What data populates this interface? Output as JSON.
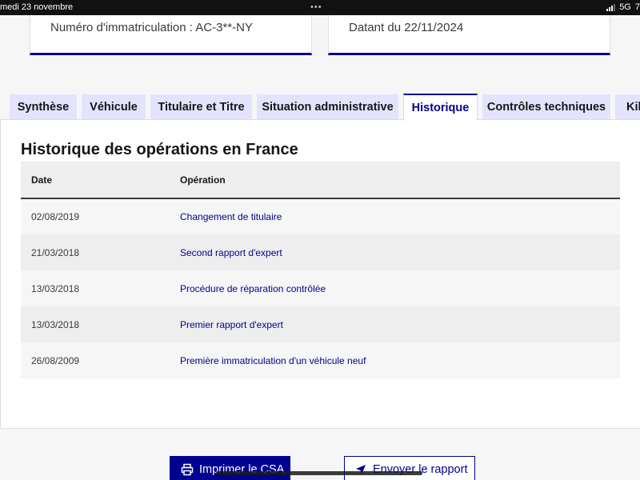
{
  "status_bar": {
    "date": "medi 23 novembre",
    "dots": "•••",
    "network": "5G",
    "battery": "7"
  },
  "cards": {
    "registration": "Numéro d'immatriculation : AC-3**-NY",
    "dated": "Datant du 22/11/2024"
  },
  "tabs": [
    {
      "label": "Synthèse",
      "active": false
    },
    {
      "label": "Véhicule",
      "active": false
    },
    {
      "label": "Titulaire et Titre",
      "active": false
    },
    {
      "label": "Situation administrative",
      "active": false
    },
    {
      "label": "Historique",
      "active": true
    },
    {
      "label": "Contrôles techniques",
      "active": false
    },
    {
      "label": "Kilo",
      "active": false
    }
  ],
  "history": {
    "title": "Historique des opérations en France",
    "columns": [
      "Date",
      "Opération"
    ],
    "rows": [
      {
        "date": "02/08/2019",
        "operation": "Changement de titulaire"
      },
      {
        "date": "21/03/2018",
        "operation": "Second rapport d'expert"
      },
      {
        "date": "13/03/2018",
        "operation": "Procédure de réparation contrôlée"
      },
      {
        "date": "13/03/2018",
        "operation": "Premier rapport d'expert"
      },
      {
        "date": "26/08/2009",
        "operation": "Première immatriculation d'un véhicule neuf"
      }
    ]
  },
  "actions": {
    "print_label": "Imprimer le CSA",
    "send_label": "Envoyer le rapport"
  },
  "colors": {
    "accent": "#000091",
    "tab_bg": "#e3e3fd",
    "row_light": "#f6f6f6",
    "row_dark": "#eeeeee"
  },
  "icons": {
    "print": "printer-icon",
    "send": "paper-plane-icon"
  }
}
